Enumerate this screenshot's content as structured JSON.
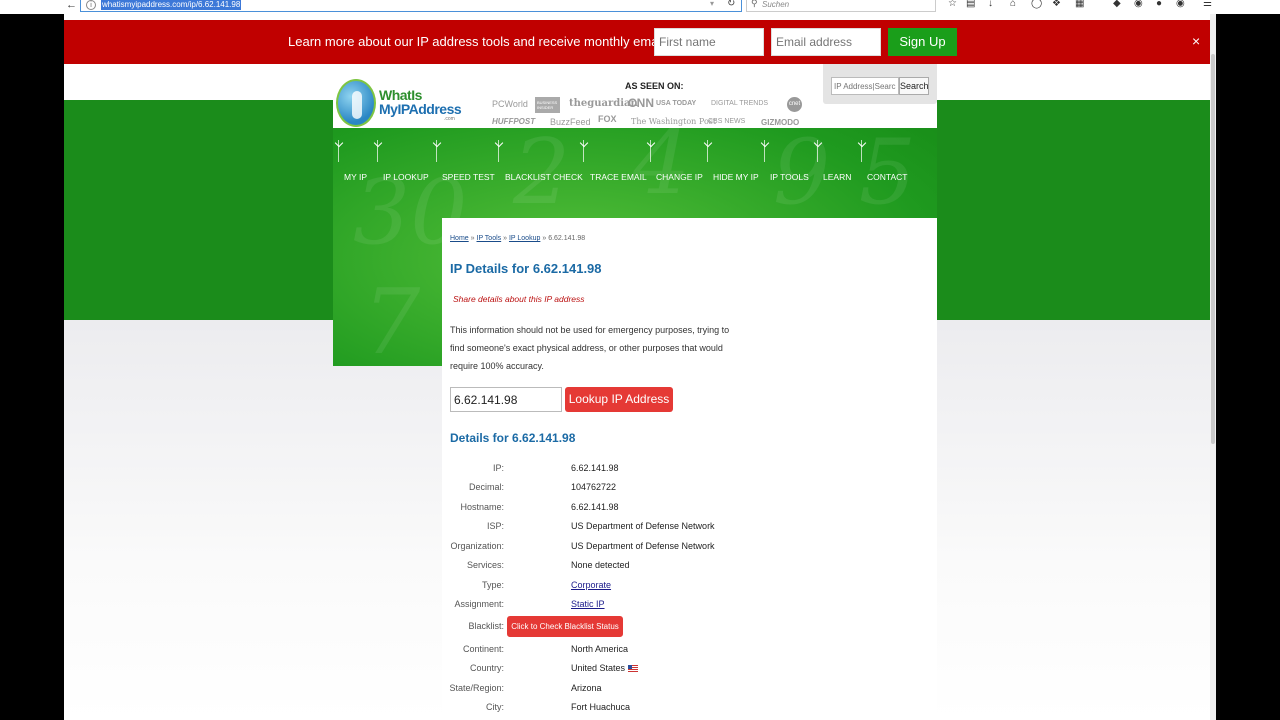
{
  "browser": {
    "url": "whatismyipaddress.com/ip/6.62.141.98",
    "search_placeholder": "Suchen"
  },
  "signup": {
    "message": "Learn more about our IP address tools and receive monthly email updates",
    "first_name_placeholder": "First name",
    "email_placeholder": "Email address",
    "signup_label": "Sign Up",
    "close_label": "×"
  },
  "logo": {
    "line1": "WhatIs",
    "line2": "MyIPAddress",
    "line3": ".com"
  },
  "seen_on": {
    "title": "AS SEEN ON:",
    "row1": [
      "PCWorld",
      "BUSINESS INSIDER",
      "theguardian",
      "CNN",
      "USA TODAY",
      "DIGITAL TRENDS",
      "cnet"
    ],
    "row2": [
      "HUFFPOST",
      "BuzzFeed",
      "FOX",
      "The Washington Post",
      "CBS NEWS",
      "GIZMODO"
    ]
  },
  "header_search": {
    "placeholder": "IP Address|Search",
    "button": "Search"
  },
  "nav": [
    "MY IP",
    "IP LOOKUP",
    "SPEED TEST",
    "BLACKLIST CHECK",
    "TRACE EMAIL",
    "CHANGE IP",
    "HIDE MY IP",
    "IP TOOLS",
    "LEARN",
    "CONTACT"
  ],
  "breadcrumb": {
    "home": "Home",
    "tools": "IP Tools",
    "lookup": "IP Lookup",
    "current": "6.62.141.98",
    "sep": "»"
  },
  "page": {
    "title": "IP Details for 6.62.141.98",
    "share": "Share details about this IP address",
    "disclaimer": "This information should not be used for emergency purposes, trying to find someone's exact physical address, or other purposes that would require 100% accuracy.",
    "ip_value": "6.62.141.98",
    "lookup_button": "Lookup IP Address",
    "details_title": "Details for 6.62.141.98",
    "blacklist_button": "Click to Check Blacklist Status"
  },
  "details": [
    {
      "label": "IP:",
      "value": "6.62.141.98"
    },
    {
      "label": "Decimal:",
      "value": "104762722"
    },
    {
      "label": "Hostname:",
      "value": "6.62.141.98"
    },
    {
      "label": "ISP:",
      "value": "US Department of Defense Network"
    },
    {
      "label": "Organization:",
      "value": "US Department of Defense Network"
    },
    {
      "label": "Services:",
      "value": "None detected"
    },
    {
      "label": "Type:",
      "value": "Corporate"
    },
    {
      "label": "Assignment:",
      "value": "Static IP"
    },
    {
      "label": "Blacklist:",
      "value": ""
    },
    {
      "label": "Continent:",
      "value": "North America"
    },
    {
      "label": "Country:",
      "value": "United States"
    },
    {
      "label": "State/Region:",
      "value": "Arizona"
    },
    {
      "label": "City:",
      "value": "Fort Huachuca"
    }
  ],
  "colors": {
    "red_bar": "#c00000",
    "green": "#1b8c1b",
    "accent_blue": "#1b6aa5",
    "button_red": "#e53935"
  }
}
